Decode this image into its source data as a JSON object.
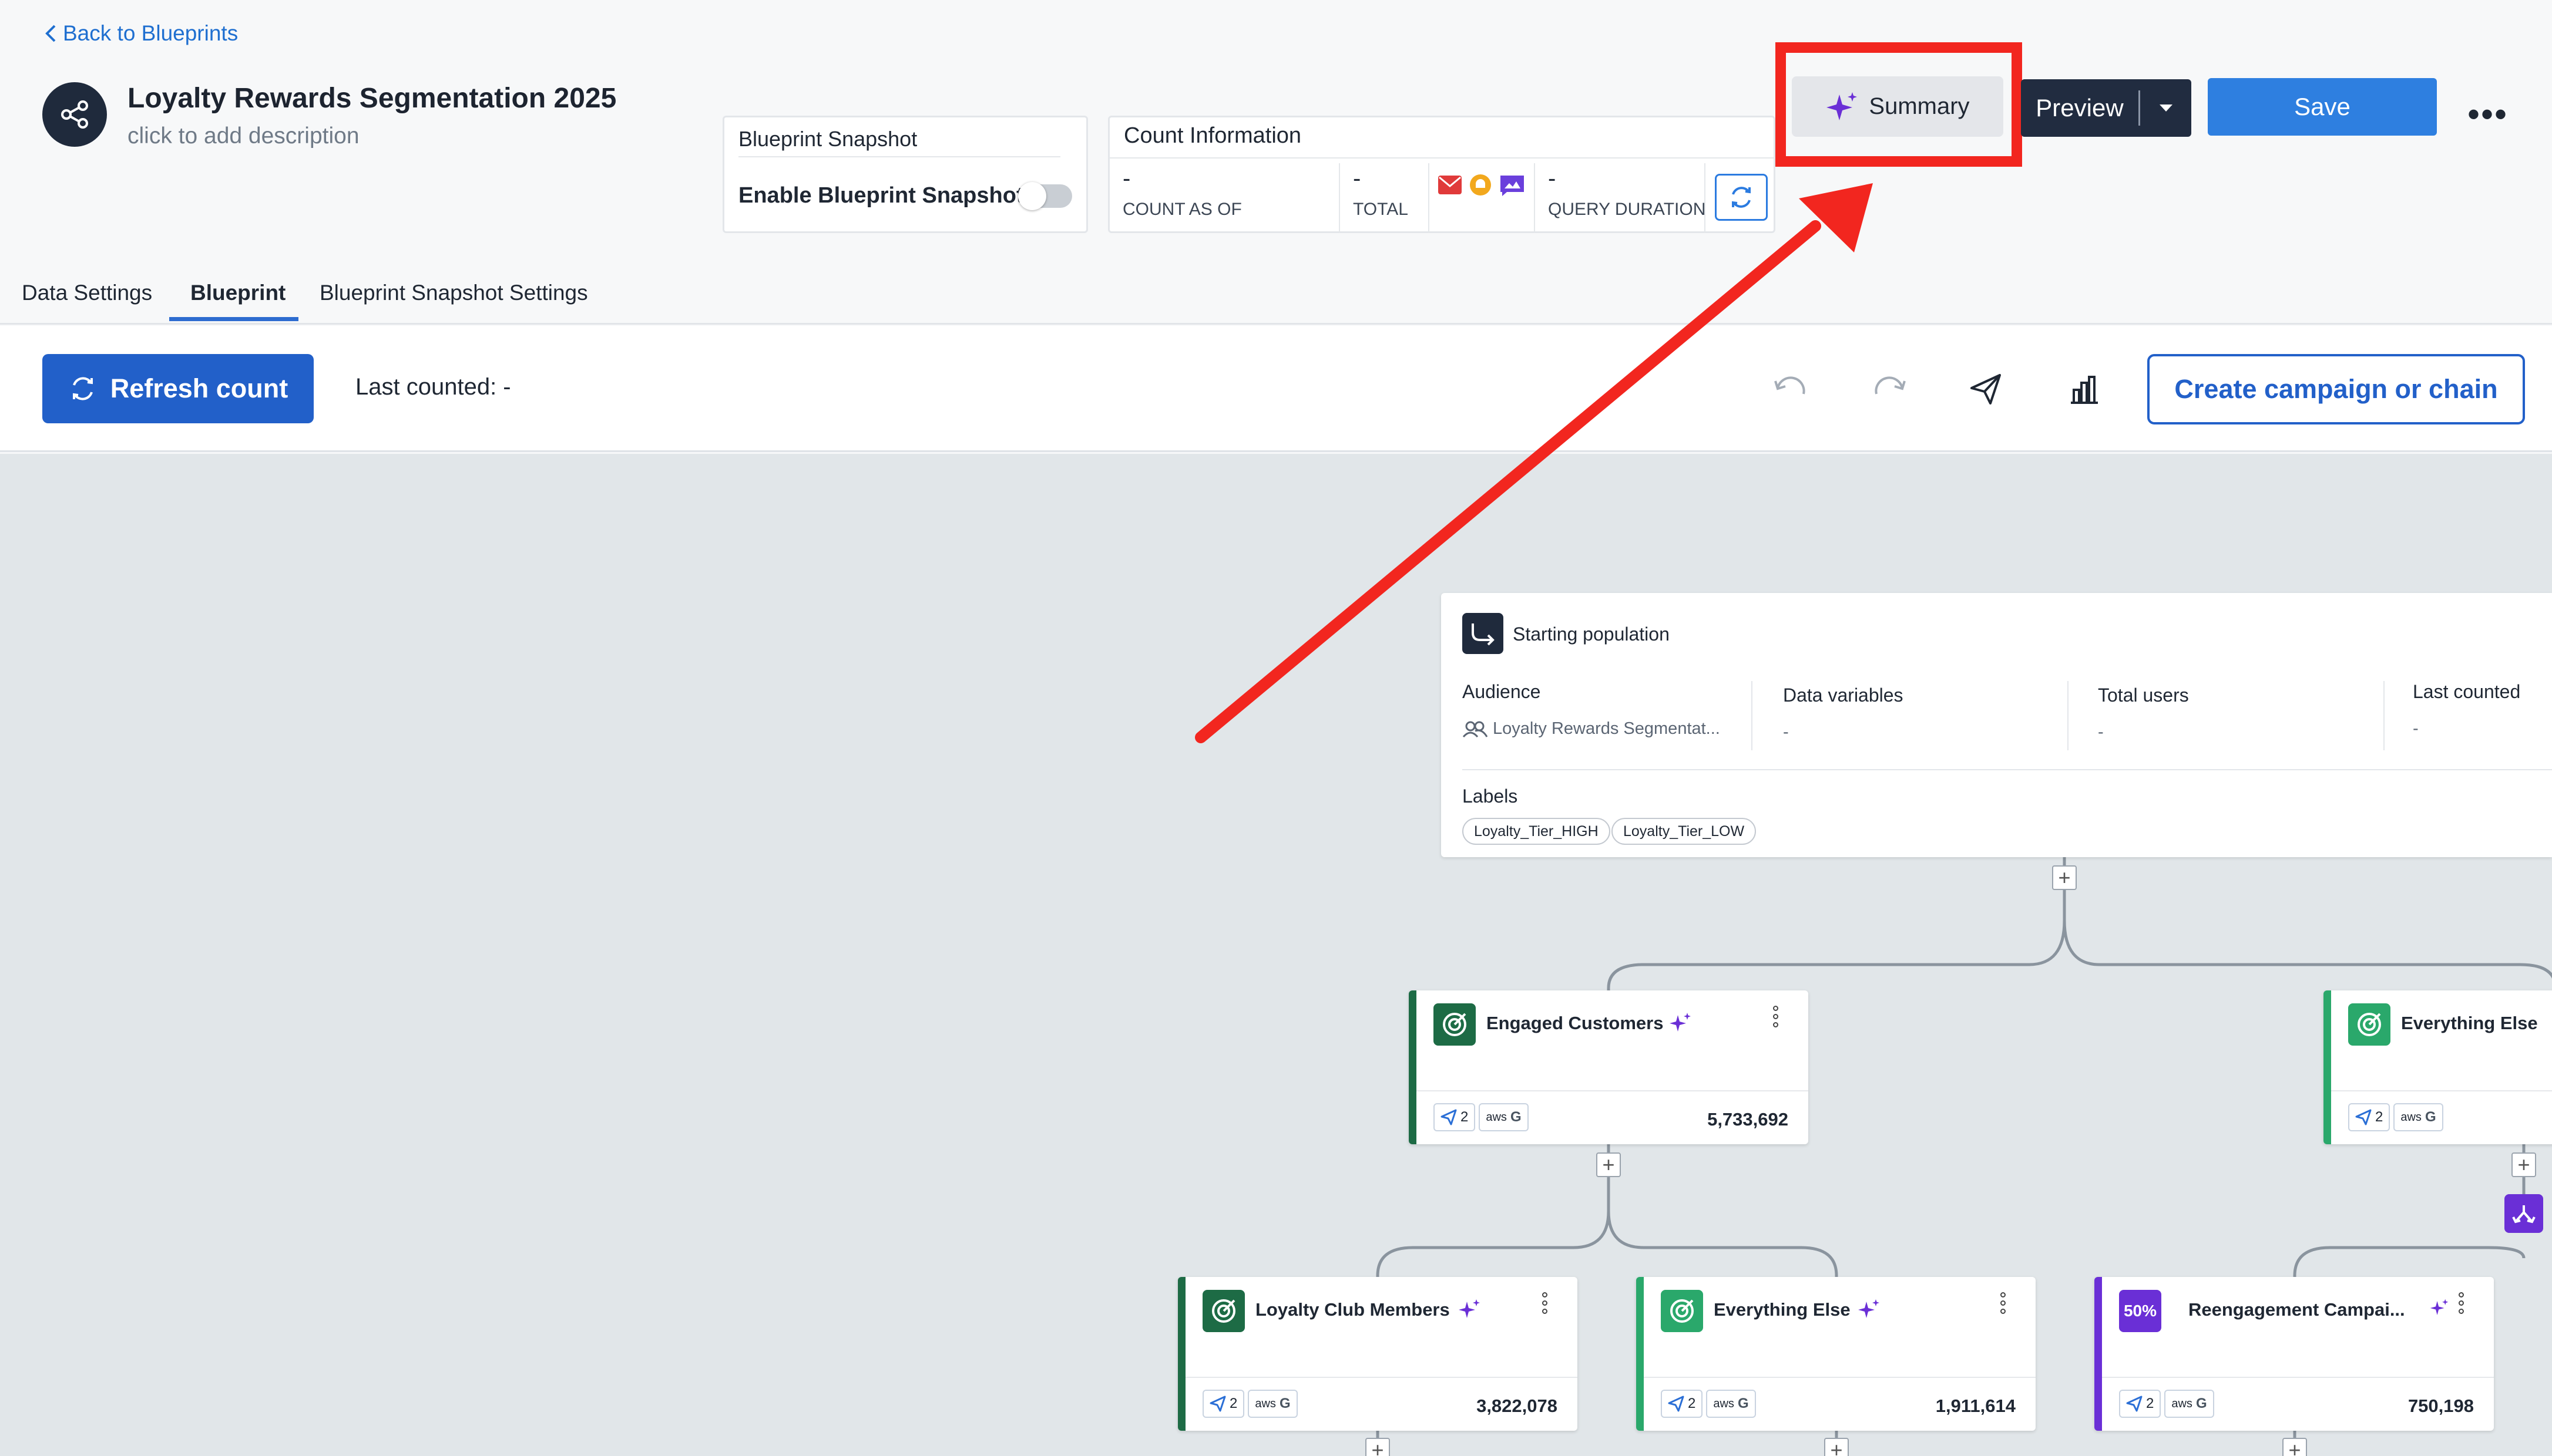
{
  "header": {
    "back_link": "Back to Blueprints",
    "title": "Loyalty Rewards Segmentation 2025",
    "description": "click to add description",
    "snapshot": {
      "title": "Blueprint Snapshot",
      "toggle_label": "Enable Blueprint Snapshot",
      "enabled": false
    },
    "count_info": {
      "title": "Count Information",
      "cells": [
        {
          "value": "-",
          "label": "COUNT AS OF"
        },
        {
          "value": "-",
          "label": "TOTAL"
        },
        {
          "value": "-",
          "label": "QUERY DURATION"
        }
      ]
    },
    "summary_label": "Summary",
    "preview_label": "Preview",
    "save_label": "Save",
    "more_label": "•••"
  },
  "tabs": [
    {
      "label": "Data Settings",
      "active": false
    },
    {
      "label": "Blueprint",
      "active": true
    },
    {
      "label": "Blueprint Snapshot Settings",
      "active": false
    }
  ],
  "toolbar": {
    "refresh_label": "Refresh count",
    "last_counted": "Last counted: -",
    "create_label": "Create campaign or chain"
  },
  "starting_population": {
    "title": "Starting population",
    "audience_header": "Audience",
    "audience_value": "Loyalty Rewards Segmentat...",
    "data_variables_header": "Data variables",
    "data_variables_value": "-",
    "total_users_header": "Total users",
    "total_users_value": "-",
    "last_counted_header": "Last counted",
    "last_counted_value": "-",
    "labels_header": "Labels",
    "labels": [
      "Loyalty_Tier_HIGH",
      "Loyalty_Tier_LOW"
    ]
  },
  "segments": [
    {
      "name": "Engaged Customers",
      "channels": "2",
      "count": "5,733,692",
      "color": "#1d6b45"
    },
    {
      "name": "Everything Else",
      "channels": "2",
      "count": "",
      "color": "#2aa86b"
    },
    {
      "name": "Loyalty Club Members",
      "channels": "2",
      "count": "3,822,078",
      "color": "#1d6b45"
    },
    {
      "name": "Everything Else",
      "channels": "2",
      "count": "1,911,614",
      "color": "#2aa86b"
    },
    {
      "name": "Reengagement Campai...",
      "channels": "2",
      "count": "750,198",
      "color": "#6a2fd6",
      "badge": "50%"
    }
  ],
  "vendor_labels": {
    "aws": "aws",
    "google": "G"
  },
  "colors": {
    "accent": "#2260c9",
    "save": "#2e7fe0",
    "preview": "#212c40",
    "highlight": "#f2261f",
    "purple": "#6a2fd6"
  }
}
